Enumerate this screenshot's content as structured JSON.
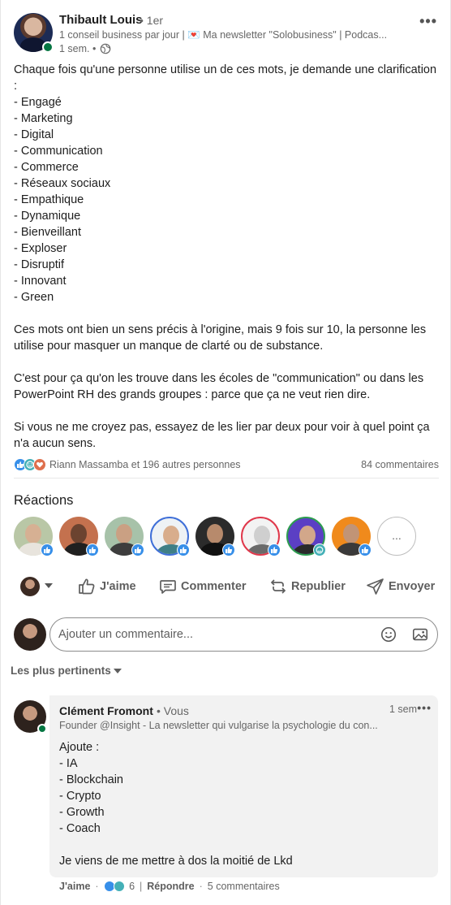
{
  "post": {
    "author": {
      "name": "Thibault Louis",
      "degree": "• 1er",
      "subtitle": "1 conseil business par jour | 💌 Ma newsletter \"Solobusiness\" | Podcas...",
      "time": "1 sem. •"
    },
    "body_lines": [
      "Chaque fois qu'une personne utilise un de ces mots, je demande une clarification",
      ":",
      "- Engagé",
      "- Marketing",
      "- Digital",
      "- Communication",
      "- Commerce",
      "- Réseaux sociaux",
      "- Empathique",
      "- Dynamique",
      "- Bienveillant",
      "- Exploser",
      "- Disruptif",
      "- Innovant",
      "- Green",
      "",
      "Ces mots ont bien un sens précis à l'origine, mais 9 fois sur 10, la personne les",
      "utilise pour masquer un manque de clarté ou de substance.",
      "",
      "C'est pour ça qu'on les trouve dans les écoles de \"communication\" ou dans les",
      "PowerPoint RH des grands groupes : parce que ça ne veut rien dire.",
      "",
      "Si vous ne me croyez pas, essayez de les lier par deux pour voir à quel point ça",
      "n'a aucun sens."
    ],
    "reactions_summary": "Riann Massamba et 196 autres personnes",
    "comments_count": "84 commentaires"
  },
  "reactions": {
    "title": "Réactions",
    "more_label": "..."
  },
  "actions": {
    "like": "J'aime",
    "comment": "Commenter",
    "repost": "Republier",
    "send": "Envoyer"
  },
  "comment_box": {
    "placeholder": "Ajouter un commentaire..."
  },
  "sort": {
    "label": "Les plus pertinents"
  },
  "comment": {
    "name": "Clément Fromont",
    "you": "• Vous",
    "time": "1 sem",
    "subtitle": "Founder @Insight - La newsletter qui vulgarise la psychologie du con...",
    "body_lines": [
      "Ajoute :",
      "- IA",
      "- Blockchain",
      "- Crypto",
      "- Growth",
      "- Coach",
      "",
      "Je viens de me mettre à dos la moitié de Lkd"
    ],
    "like_label": "J'aime",
    "reaction_count": "6",
    "reply_label": "Répondre",
    "replies_count": "5 commentaires"
  },
  "colors": {
    "like": "#378fe9",
    "support": "#44b0b7",
    "love": "#df704d",
    "online": "#057642"
  }
}
